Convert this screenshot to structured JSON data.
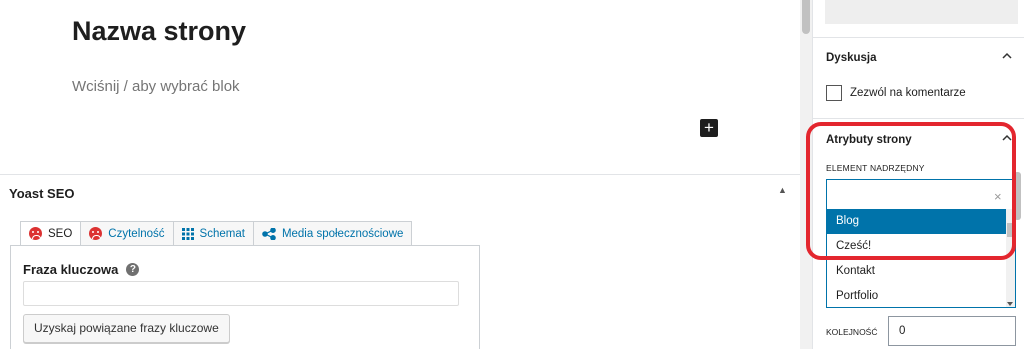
{
  "editor": {
    "page_title": "Nazwa strony",
    "block_placeholder": "Wciśnij / aby wybrać blok",
    "add_block_symbol": "+"
  },
  "yoast": {
    "header": "Yoast SEO",
    "toggle_symbol": "▲",
    "tabs": [
      {
        "label": "SEO",
        "icon": "sad-face-icon",
        "active": true
      },
      {
        "label": "Czytelność",
        "icon": "sad-face-icon",
        "active": false
      },
      {
        "label": "Schemat",
        "icon": "grid-icon",
        "active": false
      },
      {
        "label": "Media społecznościowe",
        "icon": "share-icon",
        "active": false
      }
    ],
    "fraza_label": "Fraza kluczowa",
    "help_symbol": "?",
    "fraza_value": "",
    "related_button": "Uzyskaj powiązane frazy kluczowe",
    "status_color": "#dc3232"
  },
  "sidebar": {
    "discussion": {
      "title": "Dyskusja",
      "allow_comments_label": "Zezwól na komentarze",
      "allow_comments_checked": false
    },
    "page_attributes": {
      "title": "Atrybuty strony",
      "parent_label": "ELEMENT NADRZĘDNY",
      "parent_value": "",
      "clear_symbol": "×",
      "options": [
        "Blog",
        "Cześć!",
        "Kontakt",
        "Portfolio"
      ],
      "highlighted_option": "Blog",
      "order_label": "KOLEJNOŚĆ",
      "order_value": "0"
    }
  },
  "colors": {
    "accent": "#0073aa",
    "highlight_ring": "#e3262e"
  }
}
